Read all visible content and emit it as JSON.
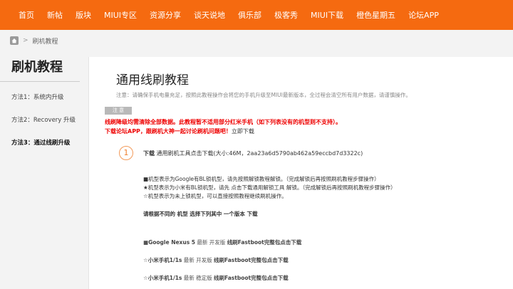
{
  "nav": [
    "首页",
    "新帖",
    "版块",
    "MIUI专区",
    "资源分享",
    "谈天说地",
    "俱乐部",
    "极客秀",
    "MIUI下载",
    "橙色星期五",
    "论坛APP"
  ],
  "breadcrumb": {
    "sep": ">",
    "current": "刷机教程"
  },
  "sidebar": {
    "title": "刷机教程",
    "items": [
      "方法1：系统内升级",
      "方法2：Recovery 升级",
      "方法3：通过线刷升级"
    ]
  },
  "main": {
    "title": "通用线刷教程",
    "notice": "注意：请确保手机电量充足，按照此教程操作会将您的手机升级至MIUI最新版本，全过程会清空所有用户数据，请谨慎操作。",
    "tag": "注 意",
    "warning1": "线刷降级均需清除全部数据。此教程暂不适用部分红米手机（如下列表没有的机型则不支持）。",
    "warning2_red": "下载论坛APP，跟刷机大神一起讨论刷机问题吧！",
    "warning2_link": "立即下载",
    "step_number": "1",
    "step_label": "下载",
    "step_text": " 通用刷机工具点击下载(大小:46M，2aa23a6d5790ab462a59eccbd7d3322c)",
    "info_lines": [
      "■机型表示为Google有BL锁机型，请先按照解锁教程解锁。（完成解锁后再按照刷机教程步骤操作）",
      "★机型表示为小米有BL锁机型，请先 点击下载通用解锁工具 解锁。（完成解锁后再按照刷机教程步骤操作）",
      "☆机型表示为未上锁机型，可以直接按照教程继续刷机操作。"
    ],
    "choose": "请根据不同的 机型 选择下列其中 一个版本 下载",
    "downloads": [
      {
        "prefix": "■",
        "model": "Google Nexus 5",
        "mid": " 最新 开发版 ",
        "tail": "线刷Fastboot完整包点击下载"
      },
      {
        "prefix": "☆",
        "model": "小米手机1/1s",
        "mid": " 最新 开发版 ",
        "tail": "线刷Fastboot完整包点击下载"
      },
      {
        "prefix": "☆",
        "model": "小米手机1/1s",
        "mid": " 最新 稳定版 ",
        "tail": "线刷Fastboot完整包点击下载"
      }
    ]
  },
  "colors": {
    "accent": "#f56a10",
    "warning": "#e00000"
  }
}
